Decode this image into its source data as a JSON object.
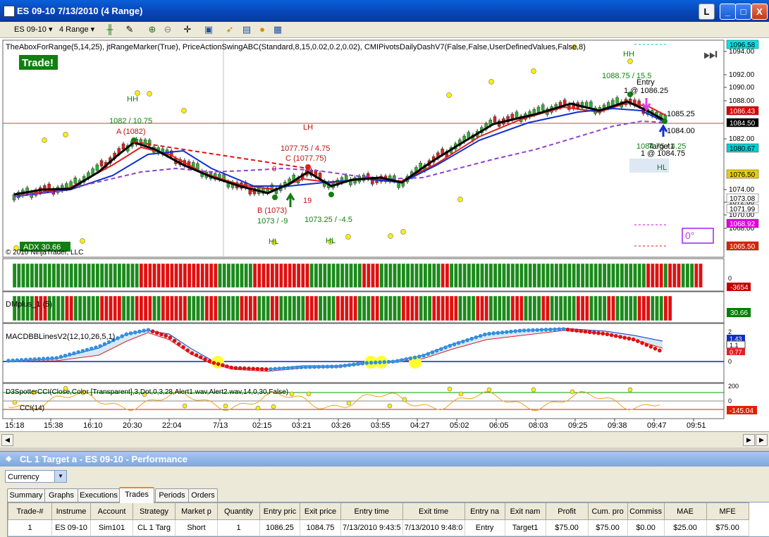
{
  "window": {
    "title": "ES 09-10  7/13/2010 (4 Range)",
    "buttons": [
      "L",
      "_",
      "□",
      "X"
    ]
  },
  "toolbar": {
    "instrument": "ES 09-10",
    "interval": "4 Range"
  },
  "chart": {
    "indicator_line": "TheAboxForRange(5,14,25), jtRangeMarker(True), PriceActionSwingABC(Standard,8,15,0.02,0.2,0.02), CMIPivotsDailyDashV7(False,False,UserDefinedValues,False,8)",
    "trade_badge": "Trade!",
    "adx_badge": "ADX 30.66",
    "copyright": "© 2010 NinjaTrader, LLC",
    "angle_box": "0°",
    "annotations": {
      "hh1": "HH",
      "hh2": "HH",
      "a_val": "1082 / 10.75",
      "a_lbl": "A (1082)",
      "lh": "LH",
      "c_val": "1077.75 / 4.75",
      "c_lbl": "C (1077.75)",
      "zero": "0",
      "one": "1",
      "nineteen": "19",
      "b_lbl": "B (1073)",
      "b_val": "1073 / -9",
      "hl_val": "1073.25 / -4.5",
      "hl1": "HL",
      "hl2": "HL",
      "hh_val": "1088.75 / 15.5",
      "entry": "Entry",
      "entry_qty": "1 @ 1086.25",
      "p1085": "1085.25",
      "p1084": "1084.00",
      "target_val": "1084.75 / 4.25",
      "target_lbl": "Target1",
      "target_qty": "1 @ 1084.75",
      "hl3": "HL"
    },
    "price_axis": [
      "1094.00",
      "1092.00",
      "1090.00",
      "1088.00",
      "1082.00",
      "1074.00",
      "1072.00",
      "1070.00",
      "1068.00"
    ],
    "price_flags": [
      {
        "text": "1096.58",
        "bg": "#00e5e5",
        "fg": "#000"
      },
      {
        "text": "1086.43",
        "bg": "#e00000",
        "fg": "#fff"
      },
      {
        "text": "1084.50",
        "bg": "#000000",
        "fg": "#fff"
      },
      {
        "text": "1080.67",
        "bg": "#00d0d0",
        "fg": "#000"
      },
      {
        "text": "1076.50",
        "bg": "#e8d000",
        "fg": "#000"
      },
      {
        "text": "1073.08",
        "bg": "#ffffff",
        "fg": "#000"
      },
      {
        "text": "1071.99",
        "bg": "#ffffff",
        "fg": "#000"
      },
      {
        "text": "1068.92",
        "bg": "#e000e0",
        "fg": "#fff"
      },
      {
        "text": "1065.50",
        "bg": "#e02000",
        "fg": "#fff"
      }
    ],
    "panel2": {
      "flag": "-3654",
      "flag_bg": "#c00000",
      "zero": "0"
    },
    "panel3": {
      "label": "DMplus_1 (5)",
      "flag": "30.66",
      "flag_bg": "#008000"
    },
    "panel4": {
      "label": "MACDBBLinesV2(12,10,26,5,1)",
      "ticks": [
        "2",
        "0"
      ],
      "flags": [
        "1.43",
        "1.1",
        "0.77"
      ]
    },
    "panel5": {
      "label": "D3SpotterCCI(Close,Color [Transparent],3,Dot,0,3,28,Alert1.wav,Alert2.wav,14,0,30,False)",
      "sublabel": "CCI(14)",
      "ticks": [
        "200",
        "0"
      ],
      "flag": "-145.04"
    },
    "time_axis": [
      "15:18",
      "15:38",
      "16:10",
      "20:30",
      "22:04",
      "7/13",
      "02:15",
      "03:21",
      "03:26",
      "03:55",
      "04:27",
      "05:02",
      "06:05",
      "08:03",
      "09:25",
      "09:38",
      "09:47",
      "09:51"
    ],
    "colors": {
      "green": "#1b8a1b",
      "red": "#e01010",
      "blue": "#1030d0",
      "purple": "#9040d0",
      "black": "#000000"
    }
  },
  "performance": {
    "title": "CL 1 Target a - ES 09-10 - Performance",
    "currency": "Currency",
    "tabs": [
      "Summary",
      "Graphs",
      "Executions",
      "Trades",
      "Periods",
      "Orders"
    ],
    "active_tab": "Trades",
    "columns": [
      "Trade-#",
      "Instrume",
      "Account",
      "Strategy",
      "Market p",
      "Quantity",
      "Entry pric",
      "Exit price",
      "Entry time",
      "Exit time",
      "Entry na",
      "Exit nam",
      "Profit",
      "Cum. pro",
      "Commiss",
      "MAE",
      "MFE"
    ],
    "rows": [
      [
        "1",
        "ES 09-10",
        "Sim101",
        "CL 1 Targ",
        "Short",
        "1",
        "1086.25",
        "1084.75",
        "7/13/2010 9:43:5",
        "7/13/2010 9:48:0",
        "Entry",
        "Target1",
        "$75.00",
        "$75.00",
        "$0.00",
        "$25.00",
        "$75.00"
      ]
    ]
  }
}
